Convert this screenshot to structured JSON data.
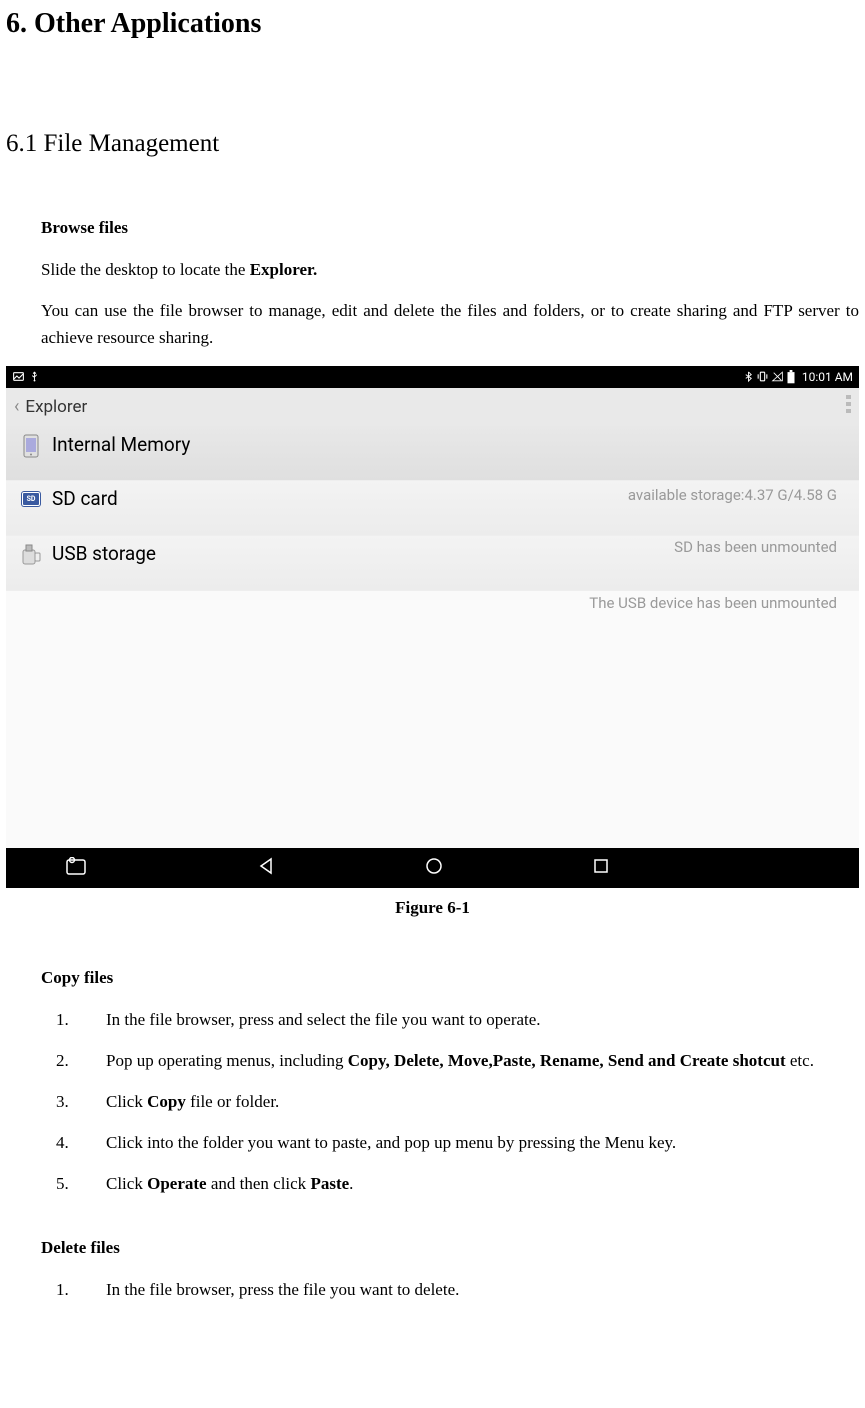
{
  "heading_main": "6. Other Applications",
  "heading_sub": "6.1 File Management",
  "browse": {
    "title": "Browse files",
    "p1_a": "Slide the desktop to locate the ",
    "p1_b": "Explorer.",
    "p2": "You can use the file browser to manage, edit and delete the files and folders, or to create sharing and FTP server to achieve resource sharing."
  },
  "screenshot": {
    "status_time": "10:01 AM",
    "header_title": "Explorer",
    "items": [
      {
        "label": "Internal Memory",
        "status": "available storage:4.37 G/4.58 G"
      },
      {
        "label": "SD card",
        "status": "SD has been unmounted"
      },
      {
        "label": "USB storage",
        "status": "The USB device has been unmounted"
      }
    ]
  },
  "figure_caption": "Figure 6-1",
  "copy": {
    "title": "Copy files",
    "s1": "In the file browser, press and select the file you want to operate.",
    "s2_a": "Pop up operating menus, including ",
    "s2_b": "Copy, Delete, Move,Paste, Rename, Send and Create shotcut",
    "s2_c": " etc.",
    "s3_a": "Click ",
    "s3_b": "Copy",
    "s3_c": " file or folder.",
    "s4": "Click into the folder you want to paste, and pop up menu by pressing the Menu key.",
    "s5_a": "Click ",
    "s5_b": "Operate",
    "s5_c": " and then click ",
    "s5_d": "Paste",
    "s5_e": "."
  },
  "delete": {
    "title": "Delete files",
    "s1": "In the file browser, press the file you want to delete."
  }
}
